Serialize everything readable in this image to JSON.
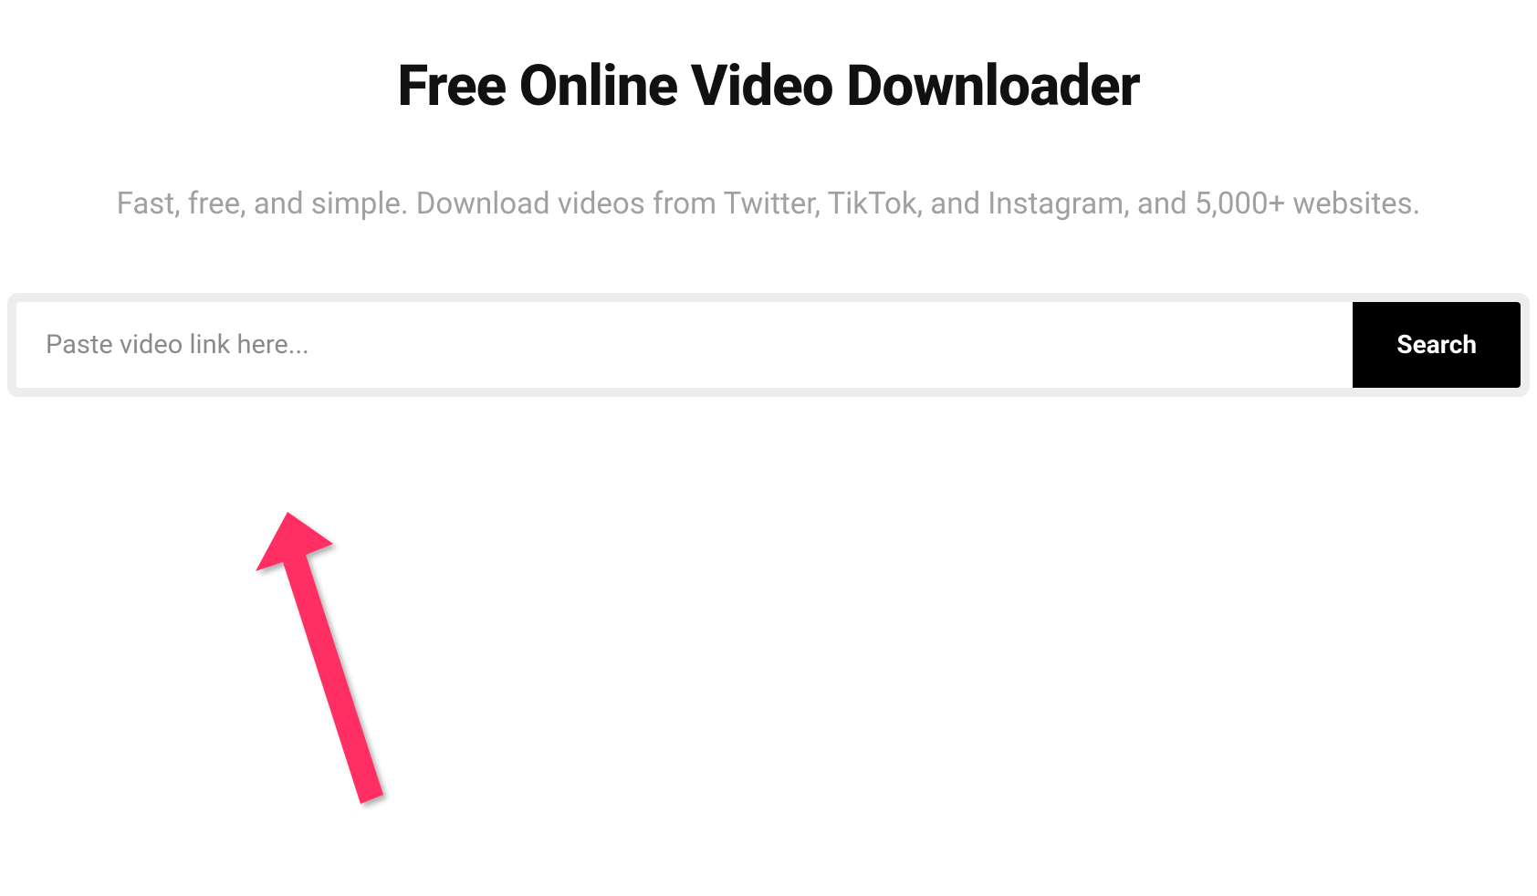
{
  "header": {
    "title": "Free Online Video Downloader",
    "subtitle": "Fast, free, and simple. Download videos from Twitter, TikTok, and Instagram, and 5,000+ websites."
  },
  "search": {
    "placeholder": "Paste video link here...",
    "value": "",
    "button_label": "Search"
  },
  "annotation": {
    "arrow_color": "#ff2e63"
  }
}
